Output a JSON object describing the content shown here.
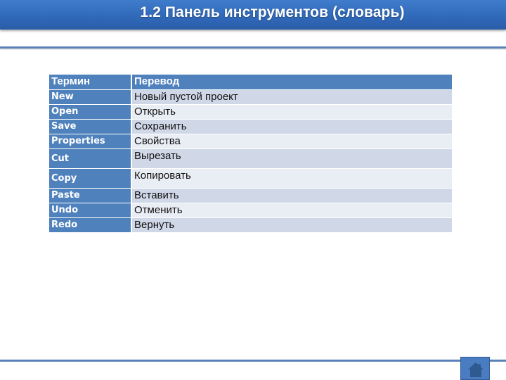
{
  "header": {
    "title": "1.2 Панель инструментов (словарь)"
  },
  "table": {
    "columns": [
      "Термин",
      "Перевод"
    ],
    "rows": [
      {
        "term": "New",
        "translation": "Новый пустой проект"
      },
      {
        "term": "Open",
        "translation": "Открыть"
      },
      {
        "term": "Save",
        "translation": "Сохранить"
      },
      {
        "term": "Properties",
        "translation": "Свойства"
      },
      {
        "term": "Cut",
        "translation": "Вырезать"
      },
      {
        "term": "Copy",
        "translation": "Копировать"
      },
      {
        "term": "Paste",
        "translation": "Вставить"
      },
      {
        "term": "Undo",
        "translation": "Отменить"
      },
      {
        "term": "Redo",
        "translation": "Вернуть"
      }
    ]
  },
  "footer": {
    "home_button_icon": "home-icon"
  },
  "colors": {
    "accent": "#4f81bd",
    "row_dark": "#d0d8e8",
    "row_light": "#e9edf4",
    "title_bar": "#3068b8"
  }
}
